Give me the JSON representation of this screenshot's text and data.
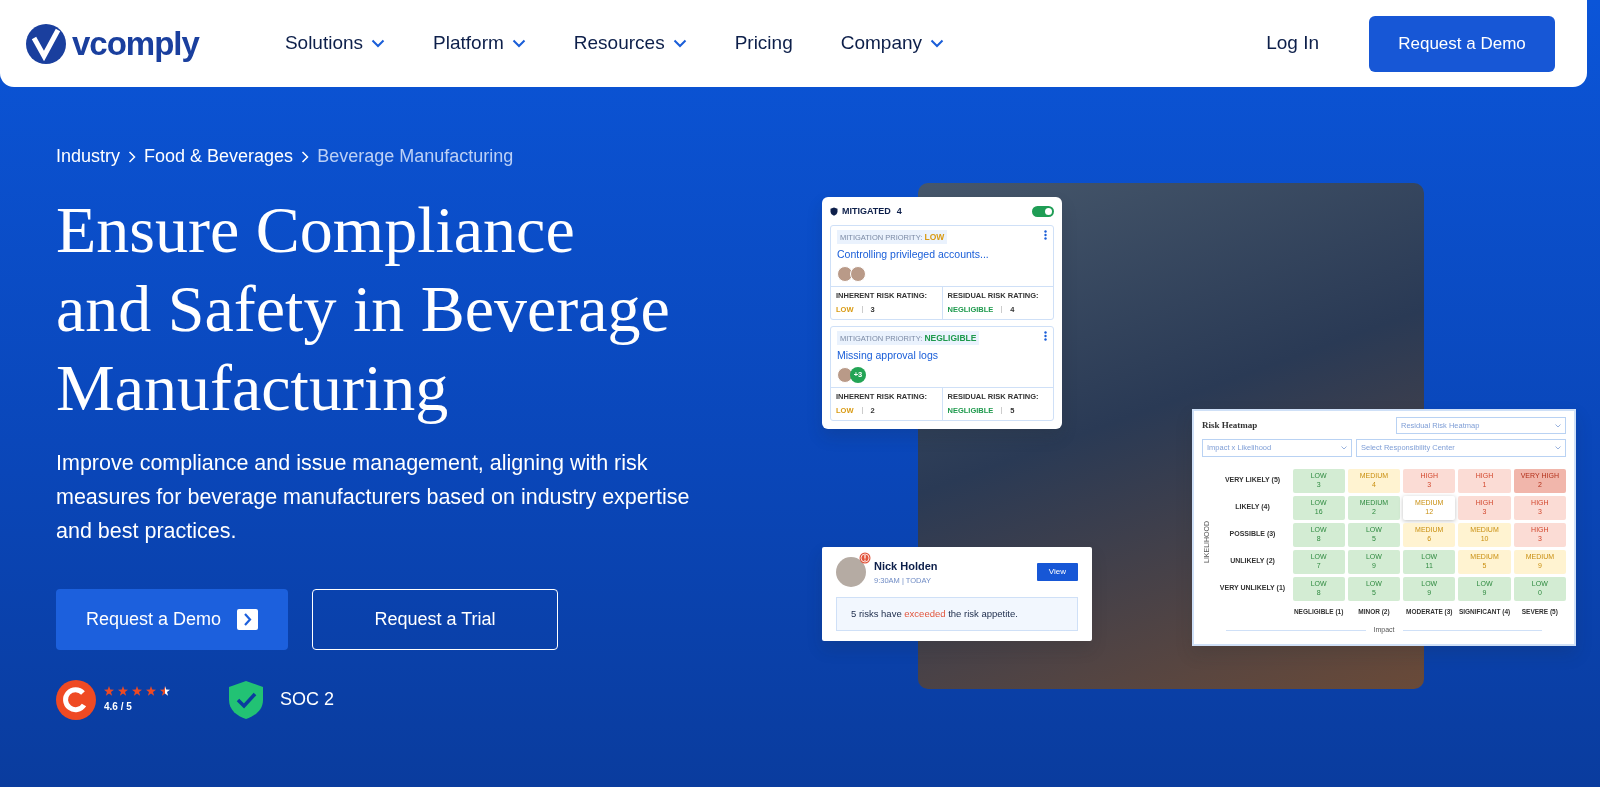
{
  "header": {
    "logo": "vcomply",
    "nav": [
      {
        "label": "Solutions",
        "has_menu": true
      },
      {
        "label": "Platform",
        "has_menu": true
      },
      {
        "label": "Resources",
        "has_menu": true
      },
      {
        "label": "Pricing",
        "has_menu": false
      },
      {
        "label": "Company",
        "has_menu": true
      }
    ],
    "login": "Log In",
    "cta": "Request a Demo"
  },
  "breadcrumb": [
    {
      "label": "Industry",
      "current": false
    },
    {
      "label": "Food & Beverages",
      "current": false
    },
    {
      "label": "Beverage Manufacturing",
      "current": true
    }
  ],
  "hero": {
    "title": "Ensure Compliance and Safety in Beverage Manufacturing",
    "description": "Improve compliance and issue management, aligning with risk measures for beverage manufacturers based on industry expertise and best practices.",
    "primary_button": "Request a Demo",
    "secondary_button": "Request a Trial"
  },
  "badges": {
    "g2": {
      "stars": 4.5,
      "rating": "4.6 / 5"
    },
    "soc": "SOC 2"
  },
  "mitigated_card": {
    "title": "MITIGATED",
    "count": "4",
    "on": true,
    "items": [
      {
        "priority_label": "MITIGATION PRIORITY:",
        "priority": {
          "text": "LOW",
          "color": "#d99a12"
        },
        "title": "Controlling privileged accounts...",
        "avatars": [
          {
            "kind": "photo"
          },
          {
            "kind": "photo"
          }
        ],
        "inherent_label": "INHERENT RISK RATING:",
        "inherent": "LOW",
        "inherent_value": "3",
        "residual_label": "RESIDUAL RISK RATING:",
        "residual": "NEGLIGIBLE",
        "residual_value": "4"
      },
      {
        "priority_label": "MITIGATION PRIORITY:",
        "priority": {
          "text": "NEGLIGIBLE",
          "color": "#1e9a4d"
        },
        "title": "Missing approval logs",
        "avatars": [
          {
            "kind": "photo"
          }
        ],
        "extra": "+3",
        "inherent_label": "INHERENT RISK RATING:",
        "inherent": "LOW",
        "inherent_value": "2",
        "residual_label": "RESIDUAL RISK RATING:",
        "residual": "NEGLIGIBLE",
        "residual_value": "5"
      }
    ]
  },
  "notification": {
    "name": "Nick Holden",
    "time": "9:30AM | TODAY",
    "button": "View",
    "message": "5 risks have **exceeded** the risk appetite."
  },
  "heatmap": {
    "title": "Risk Heatmap",
    "view_select": "Residual Risk Heatmap",
    "axis_select": "Impact x Likelihood",
    "center_select": "Select Responsibility Center",
    "y_axis": "LIKELIHOOD",
    "x_axis": "Impact",
    "likelihood_rows": [
      {
        "label": "VERY LIKELY (5)",
        "cells": [
          {
            "kind": "low",
            "text": "LOW",
            "value": "3"
          },
          {
            "kind": "medium",
            "text": "MEDIUM",
            "value": "4"
          },
          {
            "kind": "high",
            "text": "HIGH",
            "value": "3"
          },
          {
            "kind": "high",
            "text": "HIGH",
            "value": "1"
          },
          {
            "kind": "very_high",
            "text": "VERY HIGH",
            "value": "2"
          }
        ]
      },
      {
        "label": "LIKELY (4)",
        "cells": [
          {
            "kind": "low",
            "text": "LOW",
            "value": "16"
          },
          {
            "kind": "low",
            "text": "MEDIUM",
            "value": "2"
          },
          {
            "kind": "focus",
            "text": "MEDIUM",
            "value": "12"
          },
          {
            "kind": "high",
            "text": "HIGH",
            "value": "3"
          },
          {
            "kind": "high",
            "text": "HIGH",
            "value": "3"
          }
        ]
      },
      {
        "label": "POSSIBLE (3)",
        "cells": [
          {
            "kind": "low",
            "text": "LOW",
            "value": "8"
          },
          {
            "kind": "low",
            "text": "LOW",
            "value": "5"
          },
          {
            "kind": "medium",
            "text": "MEDIUM",
            "value": "6"
          },
          {
            "kind": "medium",
            "text": "MEDIUM",
            "value": "10"
          },
          {
            "kind": "high",
            "text": "HIGH",
            "value": "3"
          }
        ]
      },
      {
        "label": "UNLIKELY (2)",
        "cells": [
          {
            "kind": "low",
            "text": "LOW",
            "value": "7"
          },
          {
            "kind": "low",
            "text": "LOW",
            "value": "9"
          },
          {
            "kind": "low",
            "text": "LOW",
            "value": "11"
          },
          {
            "kind": "medium",
            "text": "MEDIUM",
            "value": "5"
          },
          {
            "kind": "medium",
            "text": "MEDIUM",
            "value": "9"
          }
        ]
      },
      {
        "label": "VERY UNLIKELY (1)",
        "cells": [
          {
            "kind": "low",
            "text": "LOW",
            "value": "8"
          },
          {
            "kind": "low",
            "text": "LOW",
            "value": "5"
          },
          {
            "kind": "low",
            "text": "LOW",
            "value": "9"
          },
          {
            "kind": "low",
            "text": "LOW",
            "value": "9"
          },
          {
            "kind": "low",
            "text": "LOW",
            "value": "0"
          }
        ]
      }
    ],
    "impact_levels": [
      "NEGLIGIBLE (1)",
      "MINOR (2)",
      "MODERATE (3)",
      "SIGNIFICANT (4)",
      "SEVERE (5)"
    ]
  }
}
